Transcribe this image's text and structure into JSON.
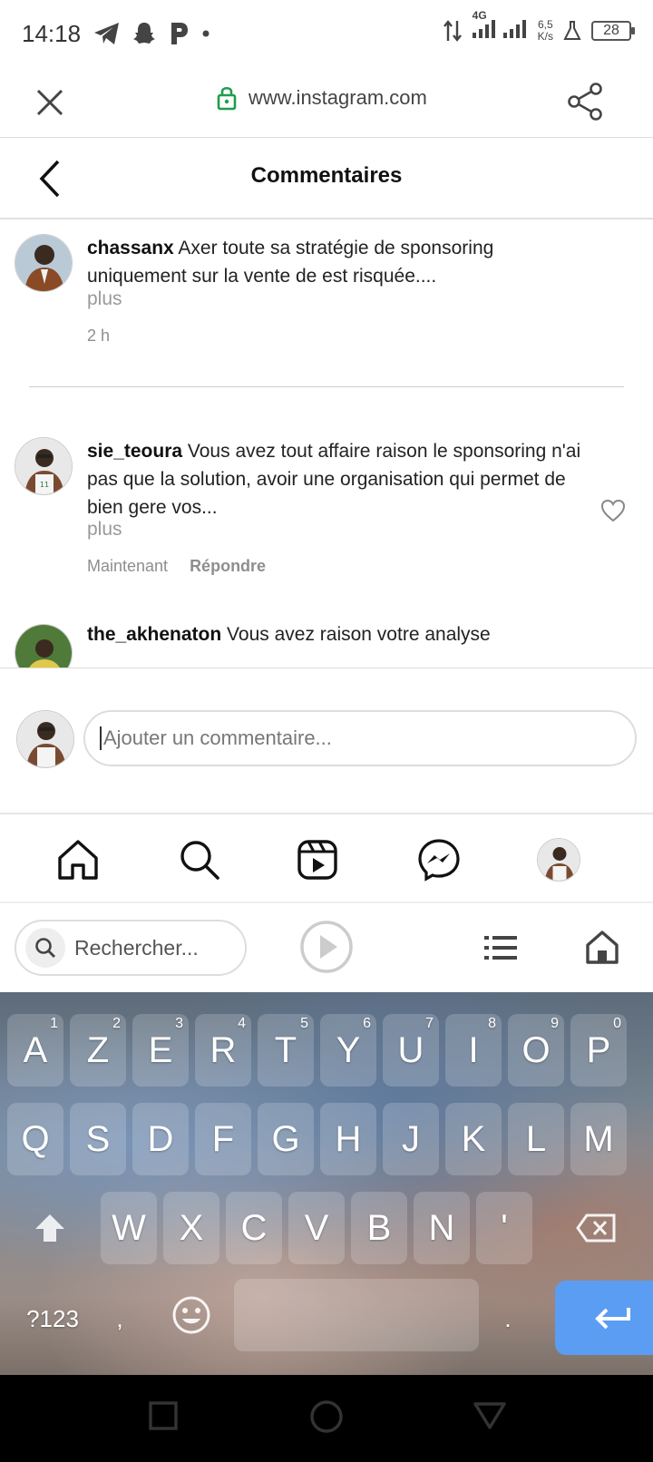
{
  "status_bar": {
    "time": "14:18",
    "network_type": "4G",
    "net_speed_value": "6,5",
    "net_speed_unit": "K/s",
    "battery": "28"
  },
  "browser": {
    "url": "www.instagram.com"
  },
  "header": {
    "title": "Commentaires"
  },
  "comments": [
    {
      "username": "chassanx",
      "text": "Axer toute sa stratégie de sponsoring uniquement sur la vente de est risquée....",
      "more": "plus",
      "time": "2 h"
    },
    {
      "username": "sie_teoura",
      "text": "Vous avez tout affaire raison le sponsoring n'ai pas que la solution, avoir une organisation qui permet de bien gere vos...",
      "more": "plus",
      "time": "Maintenant",
      "reply": "Répondre"
    },
    {
      "username": "the_akhenaton",
      "text": "Vous avez raison votre analyse"
    }
  ],
  "composer": {
    "placeholder": "Ajouter un commentaire..."
  },
  "keyboard_toolbar": {
    "search_placeholder": "Rechercher..."
  },
  "keyboard": {
    "row1": [
      {
        "k": "A",
        "n": "1"
      },
      {
        "k": "Z",
        "n": "2"
      },
      {
        "k": "E",
        "n": "3"
      },
      {
        "k": "R",
        "n": "4"
      },
      {
        "k": "T",
        "n": "5"
      },
      {
        "k": "Y",
        "n": "6"
      },
      {
        "k": "U",
        "n": "7"
      },
      {
        "k": "I",
        "n": "8"
      },
      {
        "k": "O",
        "n": "9"
      },
      {
        "k": "P",
        "n": "0"
      }
    ],
    "row2": [
      "Q",
      "S",
      "D",
      "F",
      "G",
      "H",
      "J",
      "K",
      "L",
      "M"
    ],
    "row3": [
      "W",
      "X",
      "C",
      "V",
      "B",
      "N",
      "'"
    ],
    "symbols_key": "?123",
    "comma_key": ",",
    "period_key": "."
  }
}
